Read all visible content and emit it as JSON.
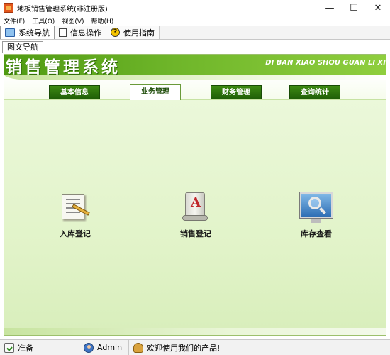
{
  "window": {
    "title": "地板销售管理系统(非注册版)",
    "controls": {
      "minimize": "—",
      "maximize": "☐",
      "close": "✕"
    }
  },
  "menu": [
    {
      "label": "文件(F)"
    },
    {
      "label": "工具(O)"
    },
    {
      "label": "视图(V)"
    },
    {
      "label": "帮助(H)"
    }
  ],
  "toolbar": [
    {
      "label": "系统导航",
      "icon": "monitor-icon",
      "active": true
    },
    {
      "label": "信息操作",
      "icon": "document-icon",
      "active": false
    },
    {
      "label": "使用指南",
      "icon": "help-icon",
      "active": false
    }
  ],
  "inner_tab": {
    "label": "图文导航"
  },
  "banner": {
    "title": "销售管理系统",
    "pinyin": "DI BAN XIAO SHOU GUAN LI XI"
  },
  "nav_tabs": [
    {
      "label": "基本信息",
      "selected": false
    },
    {
      "label": "业务管理",
      "selected": true
    },
    {
      "label": "财务管理",
      "selected": false
    },
    {
      "label": "查询统计",
      "selected": false
    }
  ],
  "features": [
    {
      "label": "入库登记",
      "icon": "notepad-pencil-icon"
    },
    {
      "label": "销售登记",
      "icon": "document-scroll-icon"
    },
    {
      "label": "库存查看",
      "icon": "monitor-magnifier-icon"
    }
  ],
  "status": {
    "ready": "准备",
    "user": "Admin",
    "message": "欢迎使用我们的产品!"
  },
  "colors": {
    "banner_dark": "#4f9a12",
    "banner_light": "#8fce3e",
    "tab_green": "#2a7009",
    "panel_bg": "#e6f6d0"
  }
}
